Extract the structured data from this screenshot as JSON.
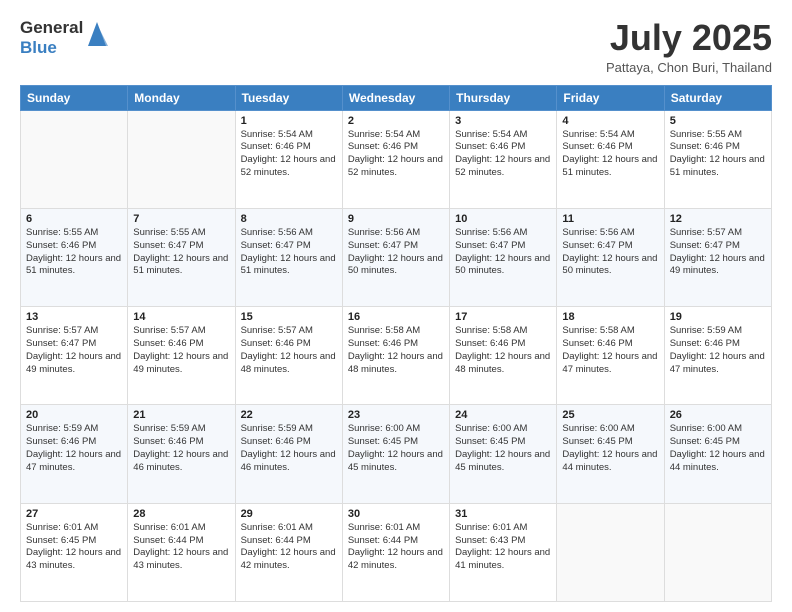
{
  "header": {
    "logo_line1": "General",
    "logo_line2": "Blue",
    "month_title": "July 2025",
    "location": "Pattaya, Chon Buri, Thailand"
  },
  "days_of_week": [
    "Sunday",
    "Monday",
    "Tuesday",
    "Wednesday",
    "Thursday",
    "Friday",
    "Saturday"
  ],
  "weeks": [
    [
      {
        "day": "",
        "info": ""
      },
      {
        "day": "",
        "info": ""
      },
      {
        "day": "1",
        "info": "Sunrise: 5:54 AM\nSunset: 6:46 PM\nDaylight: 12 hours and 52 minutes."
      },
      {
        "day": "2",
        "info": "Sunrise: 5:54 AM\nSunset: 6:46 PM\nDaylight: 12 hours and 52 minutes."
      },
      {
        "day": "3",
        "info": "Sunrise: 5:54 AM\nSunset: 6:46 PM\nDaylight: 12 hours and 52 minutes."
      },
      {
        "day": "4",
        "info": "Sunrise: 5:54 AM\nSunset: 6:46 PM\nDaylight: 12 hours and 51 minutes."
      },
      {
        "day": "5",
        "info": "Sunrise: 5:55 AM\nSunset: 6:46 PM\nDaylight: 12 hours and 51 minutes."
      }
    ],
    [
      {
        "day": "6",
        "info": "Sunrise: 5:55 AM\nSunset: 6:46 PM\nDaylight: 12 hours and 51 minutes."
      },
      {
        "day": "7",
        "info": "Sunrise: 5:55 AM\nSunset: 6:47 PM\nDaylight: 12 hours and 51 minutes."
      },
      {
        "day": "8",
        "info": "Sunrise: 5:56 AM\nSunset: 6:47 PM\nDaylight: 12 hours and 51 minutes."
      },
      {
        "day": "9",
        "info": "Sunrise: 5:56 AM\nSunset: 6:47 PM\nDaylight: 12 hours and 50 minutes."
      },
      {
        "day": "10",
        "info": "Sunrise: 5:56 AM\nSunset: 6:47 PM\nDaylight: 12 hours and 50 minutes."
      },
      {
        "day": "11",
        "info": "Sunrise: 5:56 AM\nSunset: 6:47 PM\nDaylight: 12 hours and 50 minutes."
      },
      {
        "day": "12",
        "info": "Sunrise: 5:57 AM\nSunset: 6:47 PM\nDaylight: 12 hours and 49 minutes."
      }
    ],
    [
      {
        "day": "13",
        "info": "Sunrise: 5:57 AM\nSunset: 6:47 PM\nDaylight: 12 hours and 49 minutes."
      },
      {
        "day": "14",
        "info": "Sunrise: 5:57 AM\nSunset: 6:46 PM\nDaylight: 12 hours and 49 minutes."
      },
      {
        "day": "15",
        "info": "Sunrise: 5:57 AM\nSunset: 6:46 PM\nDaylight: 12 hours and 48 minutes."
      },
      {
        "day": "16",
        "info": "Sunrise: 5:58 AM\nSunset: 6:46 PM\nDaylight: 12 hours and 48 minutes."
      },
      {
        "day": "17",
        "info": "Sunrise: 5:58 AM\nSunset: 6:46 PM\nDaylight: 12 hours and 48 minutes."
      },
      {
        "day": "18",
        "info": "Sunrise: 5:58 AM\nSunset: 6:46 PM\nDaylight: 12 hours and 47 minutes."
      },
      {
        "day": "19",
        "info": "Sunrise: 5:59 AM\nSunset: 6:46 PM\nDaylight: 12 hours and 47 minutes."
      }
    ],
    [
      {
        "day": "20",
        "info": "Sunrise: 5:59 AM\nSunset: 6:46 PM\nDaylight: 12 hours and 47 minutes."
      },
      {
        "day": "21",
        "info": "Sunrise: 5:59 AM\nSunset: 6:46 PM\nDaylight: 12 hours and 46 minutes."
      },
      {
        "day": "22",
        "info": "Sunrise: 5:59 AM\nSunset: 6:46 PM\nDaylight: 12 hours and 46 minutes."
      },
      {
        "day": "23",
        "info": "Sunrise: 6:00 AM\nSunset: 6:45 PM\nDaylight: 12 hours and 45 minutes."
      },
      {
        "day": "24",
        "info": "Sunrise: 6:00 AM\nSunset: 6:45 PM\nDaylight: 12 hours and 45 minutes."
      },
      {
        "day": "25",
        "info": "Sunrise: 6:00 AM\nSunset: 6:45 PM\nDaylight: 12 hours and 44 minutes."
      },
      {
        "day": "26",
        "info": "Sunrise: 6:00 AM\nSunset: 6:45 PM\nDaylight: 12 hours and 44 minutes."
      }
    ],
    [
      {
        "day": "27",
        "info": "Sunrise: 6:01 AM\nSunset: 6:45 PM\nDaylight: 12 hours and 43 minutes."
      },
      {
        "day": "28",
        "info": "Sunrise: 6:01 AM\nSunset: 6:44 PM\nDaylight: 12 hours and 43 minutes."
      },
      {
        "day": "29",
        "info": "Sunrise: 6:01 AM\nSunset: 6:44 PM\nDaylight: 12 hours and 42 minutes."
      },
      {
        "day": "30",
        "info": "Sunrise: 6:01 AM\nSunset: 6:44 PM\nDaylight: 12 hours and 42 minutes."
      },
      {
        "day": "31",
        "info": "Sunrise: 6:01 AM\nSunset: 6:43 PM\nDaylight: 12 hours and 41 minutes."
      },
      {
        "day": "",
        "info": ""
      },
      {
        "day": "",
        "info": ""
      }
    ]
  ]
}
